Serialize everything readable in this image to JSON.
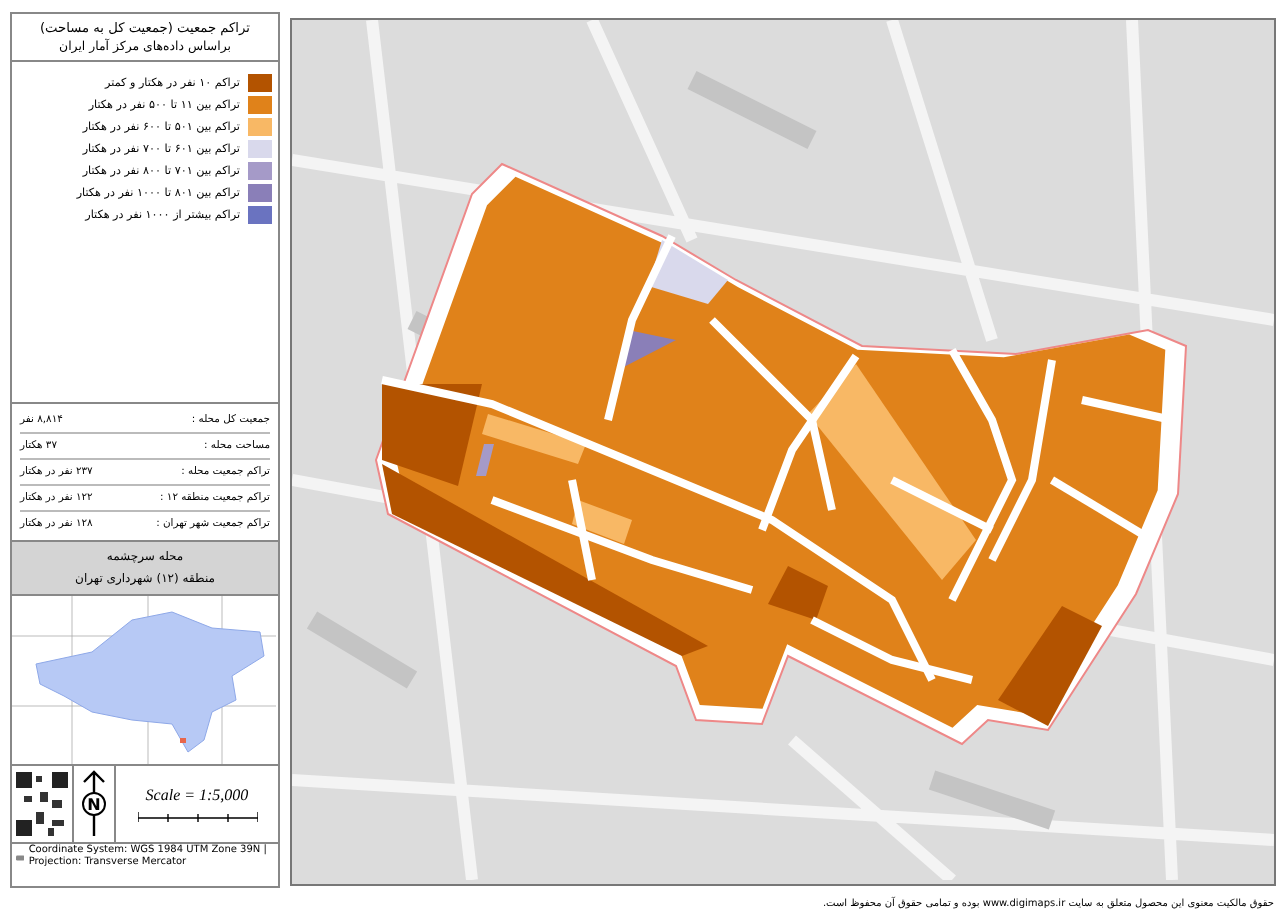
{
  "legend_panel": {
    "title": "تراکم جمعیت (جمعیت کل به مساحت)",
    "subtitle": "براساس داده‌های مرکز آمار ایران",
    "legend": [
      {
        "label": "تراکم ۱۰ نفر در هکتار و کمتر",
        "color": "#b35300"
      },
      {
        "label": "تراکم بین ۱۱ تا ۵۰۰ نفر در هکتار",
        "color": "#e0821a"
      },
      {
        "label": "تراکم بین ۵۰۱ تا ۶۰۰ نفر در هکتار",
        "color": "#f8b865"
      },
      {
        "label": "تراکم بین ۶۰۱ تا ۷۰۰ نفر در هکتار",
        "color": "#d9d9ec"
      },
      {
        "label": "تراکم بین ۷۰۱ تا ۸۰۰ نفر در هکتار",
        "color": "#a59ac8"
      },
      {
        "label": "تراکم بین ۸۰۱ تا ۱۰۰۰ نفر در هکتار",
        "color": "#8a7fb8"
      },
      {
        "label": "تراکم بیشتر از ۱۰۰۰ نفر در هکتار",
        "color": "#6a73c0"
      }
    ],
    "stats": [
      {
        "label": "جمعیت کل محله :",
        "value": "۸,۸۱۴ نفر"
      },
      {
        "label": "مساحت محله :",
        "value": "۳۷ هکتار"
      },
      {
        "label": "تراکم جمعیت محله :",
        "value": "۲۳۷ نفر در هکتار"
      },
      {
        "label": "تراکم جمعیت منطقه ۱۲ :",
        "value": "۱۲۲ نفر در هکتار"
      },
      {
        "label": "تراکم جمعیت شهر تهران :",
        "value": "۱۲۸ نفر در هکتار"
      }
    ],
    "neighborhood": "محله سرچشمه",
    "district": "منطقه (۱۲) شهرداری تهران",
    "north_label": "N",
    "scale": "Scale = 1:5,000",
    "credits": "Coordinate System: WGS 1984 UTM Zone 39N | Projection: Transverse Mercator"
  },
  "footer": "حقوق مالکیت معنوی این محصول متعلق به سایت www.digimaps.ir بوده و تمامی حقوق آن محفوظ است."
}
